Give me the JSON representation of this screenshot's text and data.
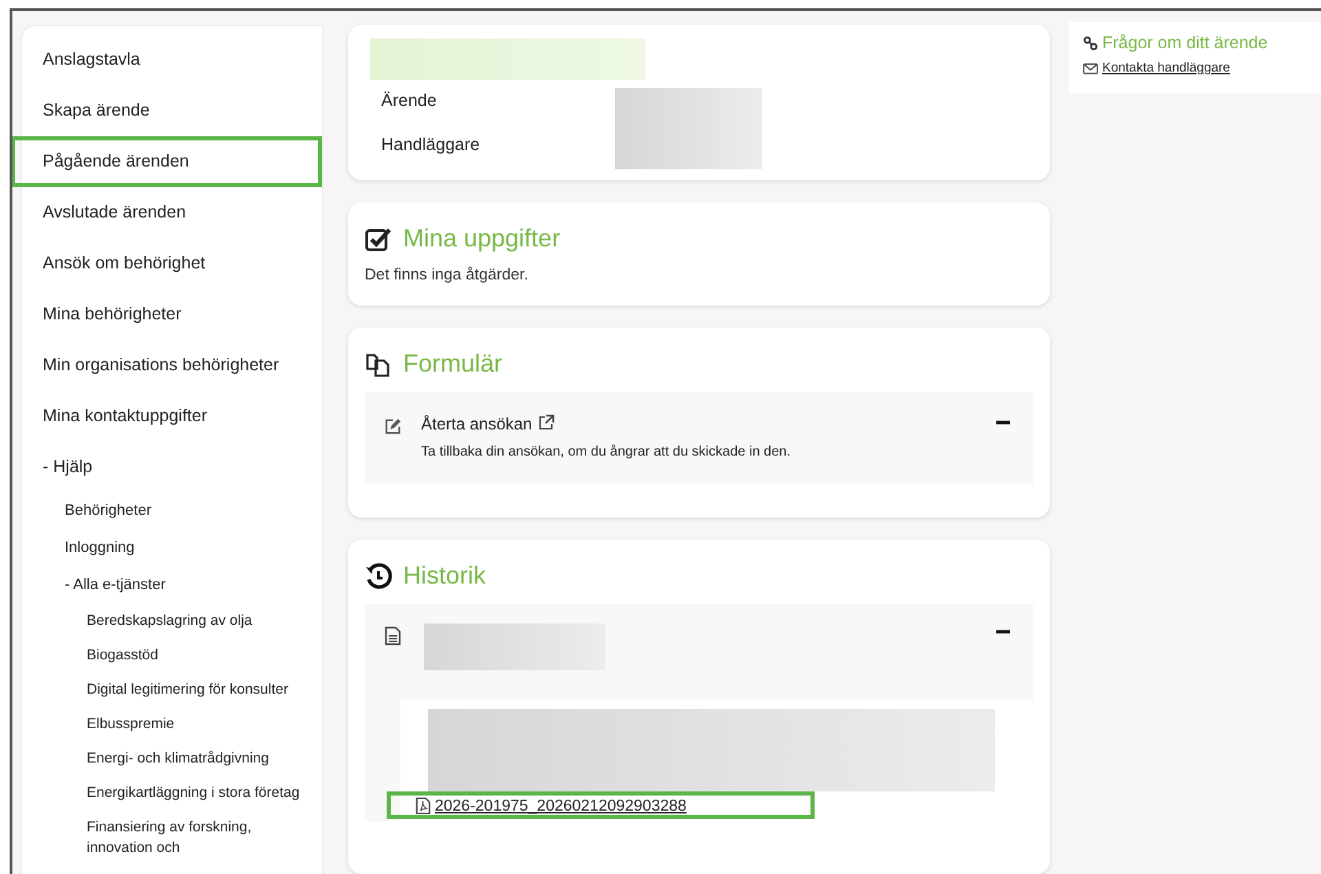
{
  "sidebar": {
    "items": [
      {
        "label": "Anslagstavla",
        "highlighted": false
      },
      {
        "label": "Skapa ärende",
        "highlighted": false
      },
      {
        "label": "Pågående ärenden",
        "highlighted": true
      },
      {
        "label": "Avslutade ärenden",
        "highlighted": false
      },
      {
        "label": "Ansök om behörighet",
        "highlighted": false
      },
      {
        "label": "Mina behörigheter",
        "highlighted": false
      },
      {
        "label": "Min organisations behörigheter",
        "highlighted": false
      },
      {
        "label": "Mina kontaktuppgifter",
        "highlighted": false
      },
      {
        "label": "- Hjälp",
        "highlighted": false,
        "children": [
          {
            "label": "Behörigheter",
            "highlighted": false
          },
          {
            "label": "Inloggning",
            "highlighted": false
          },
          {
            "label": "- Alla e-tjänster",
            "highlighted": false,
            "children": [
              {
                "label": "Beredskapslagring av olja",
                "highlighted": false
              },
              {
                "label": "Biogasstöd",
                "highlighted": false
              },
              {
                "label": "Digital legitimering för konsulter",
                "highlighted": false
              },
              {
                "label": "Elbusspremie",
                "highlighted": false
              },
              {
                "label": "Energi- och klimatrådgivning",
                "highlighted": false
              },
              {
                "label": "Energikartläggning i stora företag",
                "highlighted": false
              },
              {
                "label": "Finansiering av forskning, innovation och",
                "highlighted": false
              }
            ]
          }
        ]
      }
    ]
  },
  "case_card": {
    "fields": [
      {
        "label": "Ärende"
      },
      {
        "label": "Handläggare"
      }
    ]
  },
  "tasks": {
    "title": "Mina uppgifter",
    "message": "Det finns inga åtgärder."
  },
  "forms": {
    "title": "Formulär",
    "items": [
      {
        "title": "Återta ansökan",
        "description": "Ta tillbaka din ansökan, om du ångrar att du skickade in den.",
        "expanded": true
      }
    ]
  },
  "history": {
    "title": "Historik",
    "entries": [
      {
        "expanded": true,
        "file": {
          "name": "2026-201975_20260212092903288",
          "highlighted": true
        }
      }
    ]
  },
  "side_panel": {
    "title": "Frågor om ditt ärende",
    "link": "Kontakta handläggare"
  }
}
